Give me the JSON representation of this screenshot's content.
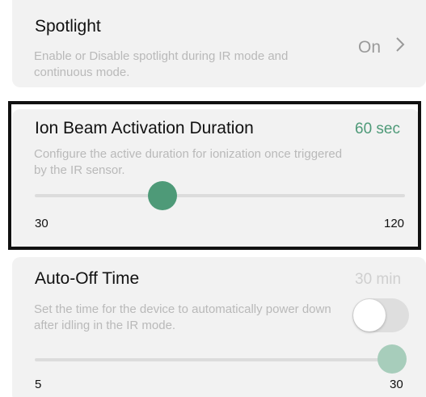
{
  "spotlight": {
    "title": "Spotlight",
    "description": "Enable or Disable spotlight during IR mode and continuous mode.",
    "value": "On",
    "chevron_icon": "chevron-right-icon"
  },
  "ion_beam": {
    "title": "Ion Beam Activation Duration",
    "value": "60 sec",
    "description": "Configure the active duration for ionization once triggered by the IR sensor.",
    "slider": {
      "min": 30,
      "max": 120,
      "current": 60,
      "min_label": "30",
      "max_label": "120"
    },
    "accent_color": "#4e9a78"
  },
  "auto_off": {
    "title": "Auto-Off Time",
    "value": "30 min",
    "description": "Set the time for the device to automatically power down after idling in the IR mode.",
    "toggle_on": false,
    "slider": {
      "min": 5,
      "max": 30,
      "current": 30,
      "min_label": "5",
      "max_label": "30"
    },
    "accent_color": "#a7cdbb"
  }
}
